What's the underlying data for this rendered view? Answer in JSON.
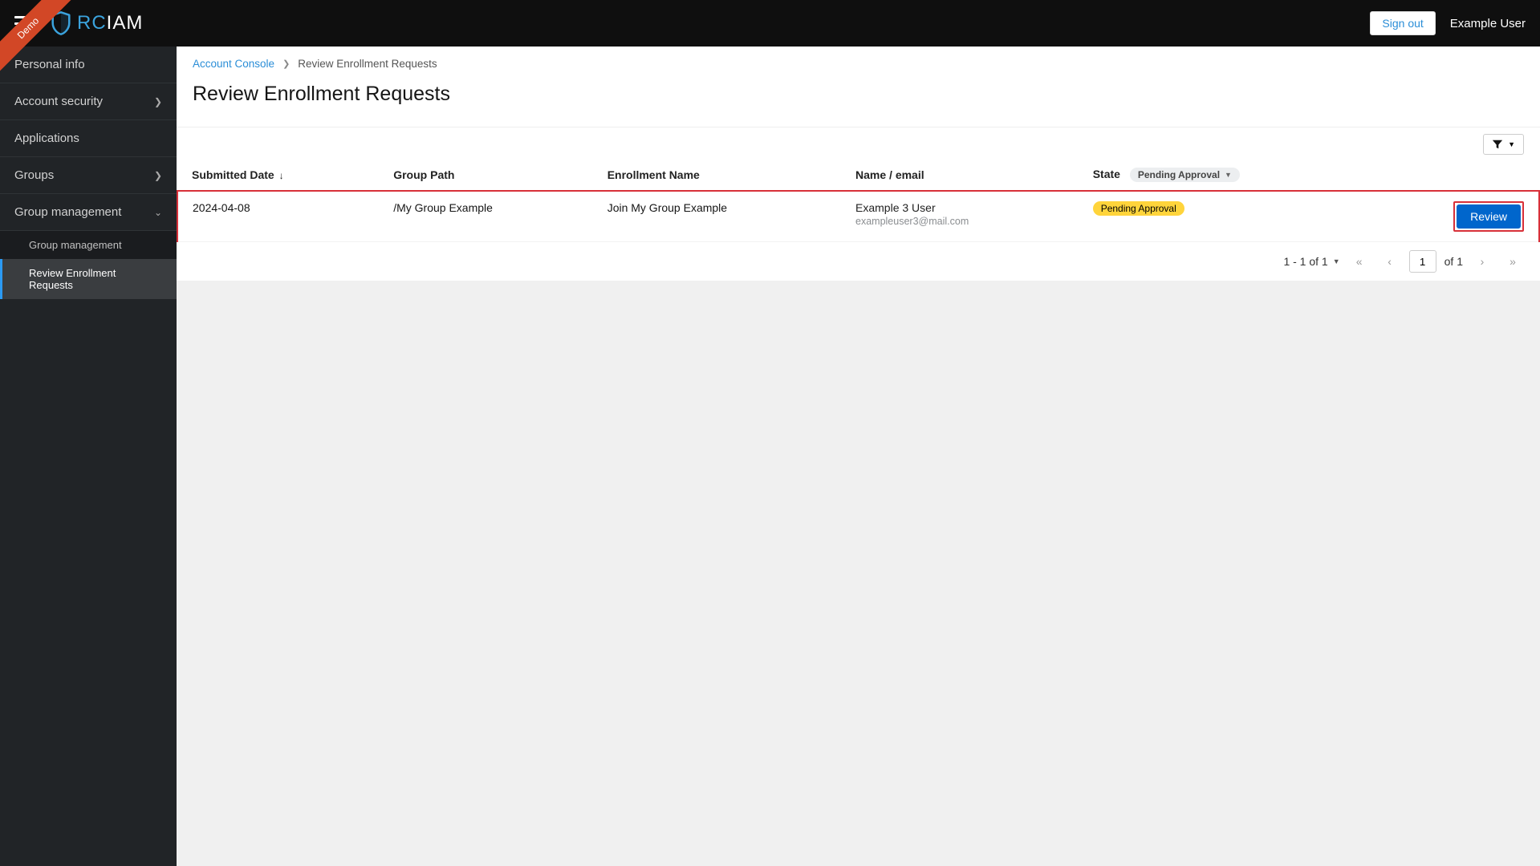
{
  "header": {
    "brand_rc": "RC",
    "brand_iam": "IAM",
    "demo_ribbon": "Demo",
    "signout_label": "Sign out",
    "user_display": "Example User"
  },
  "sidebar": {
    "items": [
      {
        "label": "Personal info",
        "expandable": false
      },
      {
        "label": "Account security",
        "expandable": true
      },
      {
        "label": "Applications",
        "expandable": false
      },
      {
        "label": "Groups",
        "expandable": true
      },
      {
        "label": "Group management",
        "expandable": true,
        "expanded": true,
        "children": [
          {
            "label": "Group management",
            "active": false
          },
          {
            "label": "Review Enrollment Requests",
            "active": true
          }
        ]
      }
    ]
  },
  "breadcrumb": {
    "root_label": "Account Console",
    "current_label": "Review Enrollment Requests"
  },
  "page": {
    "title": "Review Enrollment Requests"
  },
  "filter": {
    "state_chip_label": "Pending Approval"
  },
  "table": {
    "columns": {
      "submitted": "Submitted Date",
      "group_path": "Group Path",
      "enrollment_name": "Enrollment Name",
      "name_email": "Name / email",
      "state": "State"
    },
    "sort_indicator": "↓",
    "rows": [
      {
        "submitted": "2024-04-08",
        "group_path": "/My Group Example",
        "enrollment_name": "Join My Group Example",
        "user_name": "Example 3 User",
        "user_email": "exampleuser3@mail.com",
        "state_label": "Pending Approval",
        "action_label": "Review"
      }
    ]
  },
  "pagination": {
    "range_text": "1 - 1 of 1",
    "page_value": "1",
    "of_text": "of 1"
  }
}
